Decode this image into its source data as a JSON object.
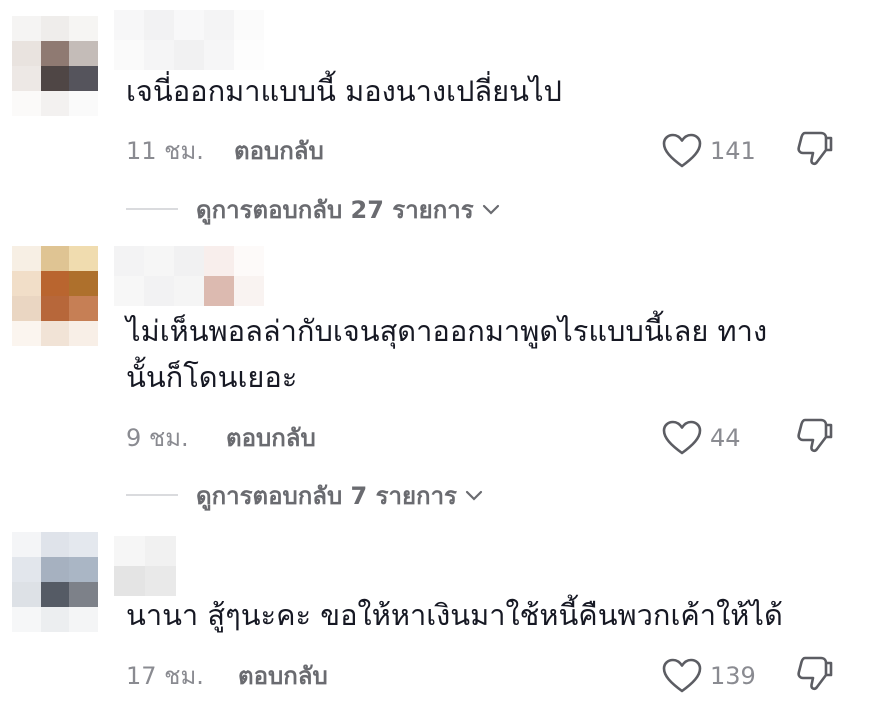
{
  "comments": [
    {
      "username": "",
      "text": "เจนี่ออกมาแบบนี้ มองนางเปลี่ยนไป",
      "time": "11 ชม.",
      "reply_label": "ตอบกลับ",
      "likes": "141",
      "view_replies": "ดูการตอบกลับ 27 รายการ"
    },
    {
      "username": "",
      "text": "ไม่เห็นพอลล่ากับเจนสุดาออกมาพูดไรแบบนี้เลย ทาง\nนั้นก็โดนเยอะ",
      "time": "9 ชม.",
      "reply_label": "ตอบกลับ",
      "likes": "44",
      "view_replies": "ดูการตอบกลับ 7 รายการ"
    },
    {
      "username": "",
      "text": "นานา สู้ๆนะคะ ขอให้หาเงินมาใช้หนี้คืนพวกเค้าให้ได้",
      "time": "17 ชม.",
      "reply_label": "ตอบกลับ",
      "likes": "139"
    }
  ],
  "icons": {
    "like": "heart-outline-icon",
    "dislike": "thumbs-down-icon",
    "expand": "chevron-down-icon"
  },
  "colors": {
    "text": "#161823",
    "secondary": "#8a8b91",
    "reply": "#6a6b70"
  }
}
